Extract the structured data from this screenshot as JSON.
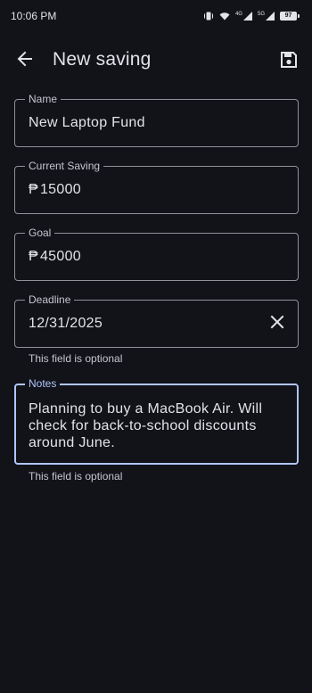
{
  "status_bar": {
    "time": "10:06 PM",
    "battery_level": "97",
    "network_1": "4G",
    "network_2": "5G",
    "icons": [
      "vibrate-icon",
      "wifi-icon",
      "signal-icon",
      "signal-icon",
      "battery-icon"
    ]
  },
  "app_bar": {
    "title": "New saving",
    "back_icon": "arrow-back-icon",
    "save_icon": "save-icon"
  },
  "form": {
    "name": {
      "label": "Name",
      "value": "New Laptop Fund"
    },
    "current_saving": {
      "label": "Current Saving",
      "prefix": "₱",
      "value": "15000"
    },
    "goal": {
      "label": "Goal",
      "prefix": "₱",
      "value": "45000"
    },
    "deadline": {
      "label": "Deadline",
      "value": "12/31/2025",
      "helper": "This field is optional",
      "clear_icon": "close-icon"
    },
    "notes": {
      "label": "Notes",
      "value": "Planning to buy a MacBook Air. Will check for back-to-school discounts around June.",
      "helper": "This field is optional"
    }
  },
  "colors": {
    "background": "#121318",
    "focus_accent": "#b1c5ff",
    "outline": "#90909a",
    "text": "#e3e2e9"
  }
}
